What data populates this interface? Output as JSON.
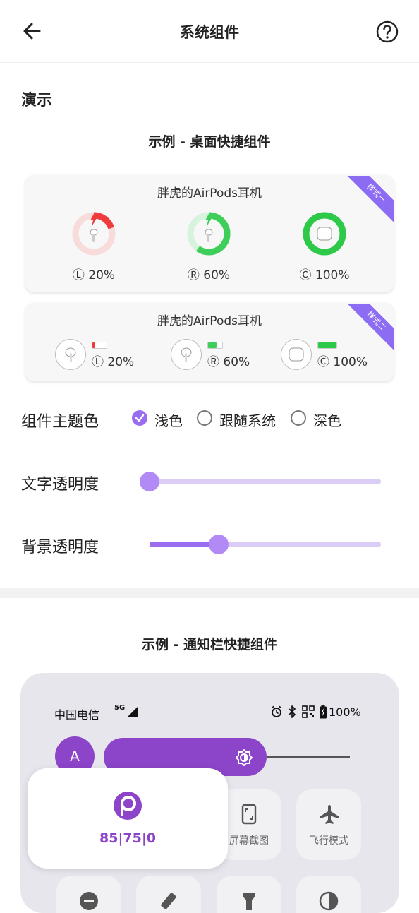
{
  "header": {
    "title": "系统组件",
    "back_icon": "arrow-left-icon",
    "help_icon": "question-circle-icon"
  },
  "demo": {
    "section_title": "演示",
    "desktop_subtitle": "示例 - 桌面快捷组件",
    "style1": {
      "name": "胖虎的AirPods耳机",
      "badge": "样式一",
      "items": [
        {
          "label": "Ⓛ 20%",
          "level": 0.2,
          "color": "#ee3b3b",
          "track": "#f8dcdc",
          "charging": true
        },
        {
          "label": "Ⓡ 60%",
          "level": 0.6,
          "color": "#3ecf5a",
          "track": "#d8f3dd",
          "charging": true
        },
        {
          "label": "Ⓒ 100%",
          "level": 1.0,
          "color": "#2fc94a",
          "track": "#d8f3dd",
          "charging": false
        }
      ]
    },
    "style2": {
      "name": "胖虎的AirPods耳机",
      "badge": "样式二",
      "items": [
        {
          "label": "Ⓛ 20%",
          "level": 0.2,
          "color": "#ee3b3b"
        },
        {
          "label": "Ⓡ 60%",
          "level": 0.6,
          "color": "#3ecf5a"
        },
        {
          "label": "Ⓒ 100%",
          "level": 1.0,
          "color": "#2fc94a"
        }
      ]
    }
  },
  "settings": {
    "theme_label": "组件主题色",
    "theme_options": [
      "浅色",
      "跟随系统",
      "深色"
    ],
    "theme_selected": "浅色",
    "text_opacity_label": "文字透明度",
    "text_opacity": 0.0,
    "bg_opacity_label": "背景透明度",
    "bg_opacity": 0.3,
    "accent_color": "#9a6cf0"
  },
  "notification": {
    "subtitle": "示例 - 通知栏快捷组件",
    "carrier": "中国电信",
    "network": "5G",
    "battery": "100%",
    "avatar_letter": "A",
    "float_values": "85|75|0",
    "tiles": [
      {
        "label": "屏幕截图",
        "icon": "screenshot-icon"
      },
      {
        "label": "飞行模式",
        "icon": "airplane-icon"
      }
    ],
    "bottom_icons": [
      "dnd-icon",
      "rotate-icon",
      "flashlight-icon",
      "contrast-icon"
    ]
  }
}
